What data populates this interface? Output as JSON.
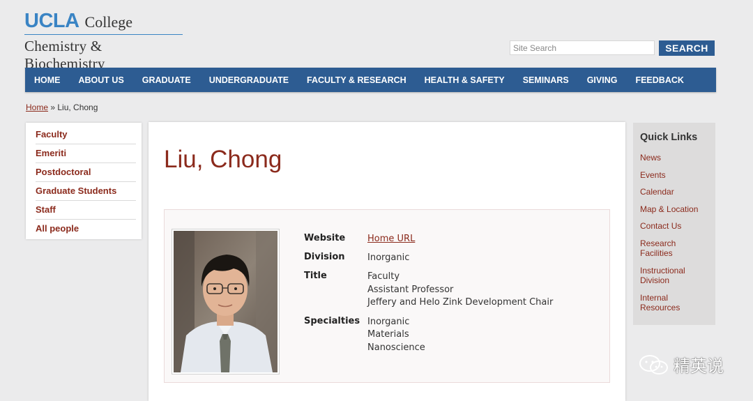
{
  "header": {
    "logo_ucla": "UCLA",
    "logo_college": "College",
    "logo_dept": "Chemistry & Biochemistry",
    "search_placeholder": "Site Search",
    "search_button": "SEARCH"
  },
  "nav": {
    "items": [
      "HOME",
      "ABOUT US",
      "GRADUATE",
      "UNDERGRADUATE",
      "FACULTY & RESEARCH",
      "HEALTH & SAFETY",
      "SEMINARS",
      "GIVING",
      "FEEDBACK"
    ]
  },
  "breadcrumb": {
    "home": "Home",
    "separator": " » ",
    "current": "Liu, Chong"
  },
  "left_nav": {
    "items": [
      "Faculty",
      "Emeriti",
      "Postdoctoral",
      "Graduate Students",
      "Staff",
      "All people"
    ]
  },
  "profile": {
    "name": "Liu, Chong",
    "website_label": "Website",
    "website_value": "Home URL",
    "division_label": "Division",
    "division_value": "Inorganic",
    "title_label": "Title",
    "title_values": [
      "Faculty",
      "Assistant Professor",
      "Jeffery and Helo Zink Development Chair"
    ],
    "specialties_label": "Specialties",
    "specialties_values": [
      "Inorganic",
      "Materials",
      "Nanoscience"
    ]
  },
  "quick_links": {
    "heading": "Quick Links",
    "items": [
      "News",
      "Events",
      "Calendar",
      "Map & Location",
      "Contact Us",
      "Research Facilities",
      "Instructional Division",
      "Internal Resources"
    ]
  },
  "watermark": {
    "text": "精英说"
  },
  "colors": {
    "brand_blue": "#2d5c92",
    "ucla_blue": "#3a84c4",
    "link_red": "#8b2a1c",
    "page_bg": "#ebebec"
  }
}
